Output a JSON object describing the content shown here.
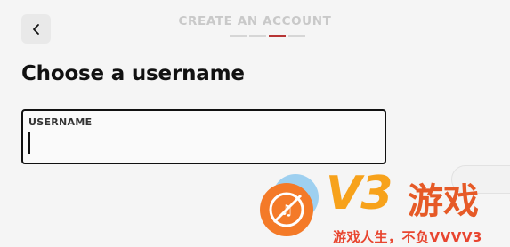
{
  "header": {
    "back_label": "Back",
    "step_title": "CREATE AN ACCOUNT",
    "progress": {
      "total_steps": 4,
      "current_step": 3
    }
  },
  "main": {
    "heading": "Choose a username",
    "username_field": {
      "label": "USERNAME",
      "value": "",
      "placeholder": ""
    }
  },
  "watermark": {
    "brand": "V3",
    "brand_cn": "游戏",
    "tagline": "游戏人生，不负VVVV3",
    "colors": {
      "orange": "#f7a21b",
      "red": "#e65a27",
      "blue": "#8ec9ee"
    }
  },
  "colors": {
    "accent": "#b73535",
    "background": "#f5f5f5",
    "muted": "#c9c9c9"
  }
}
